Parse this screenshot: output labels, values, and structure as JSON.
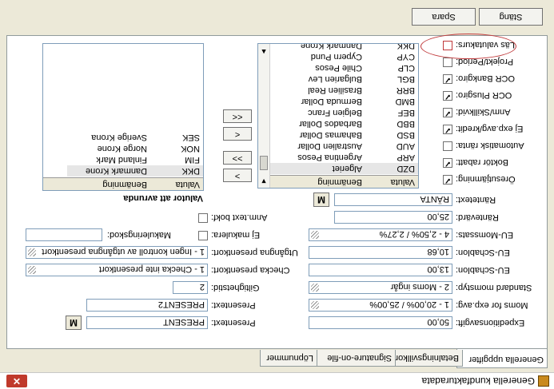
{
  "window": {
    "title": "Generella kundfakturadata",
    "close_glyph": "✕"
  },
  "tabs": [
    "Generella uppgifter",
    "Betalningsvillkor",
    "Signature-on-file",
    "Löpnummer"
  ],
  "left_fields": [
    {
      "label": "Expeditionsavgift:",
      "value": "50,00"
    },
    {
      "label": "Moms for exp.avg:",
      "value": "1 - 20,00% / 25,00%"
    },
    {
      "label": "Standard momstyp:",
      "value": "2 - Moms ingår"
    },
    {
      "label": "EU-Schablon:",
      "value": "13,00"
    },
    {
      "label": "EU-Schablon:",
      "value": "10,68"
    },
    {
      "label": "EU-Momssats:",
      "value": "4 - 2,50% / 2,27%"
    },
    {
      "label": "Räntevärd:",
      "value": "25,00"
    },
    {
      "label": "Räntetext:",
      "value": "RÄNTA"
    }
  ],
  "left_checks": [
    {
      "label": "Öresutjämning:",
      "checked": true
    },
    {
      "label": "Boktör rabatt:",
      "checked": true
    },
    {
      "label": "Automatisk ränta:",
      "checked": false
    },
    {
      "label": "Ej exp.avg/kredit:",
      "checked": true
    },
    {
      "label": "Anm/Skillkvid:",
      "checked": true
    },
    {
      "label": "OCR Plusgiro:",
      "checked": true
    },
    {
      "label": "OCR Bankgiro:",
      "checked": true
    },
    {
      "label": "Projekt/Period:",
      "checked": false
    },
    {
      "label": "Läs valutakurs:",
      "checked": false
    }
  ],
  "right_fields": {
    "presentext1_label": "Presentext:",
    "presentext1_value": "PRESENT",
    "presentext2_label": "Presentext:",
    "presentext2_value": "PRESENT2",
    "giltighetstid_label": "Giltighetstid:",
    "giltighetstid_value": "2",
    "checka_label": "Checka presentkort:",
    "checka_value": "1 - Checka inte presentkort",
    "utgangna_label": "Utgångna presentkort:",
    "utgangna_value": "1 - Ingen kontroll av utgångna presentkort",
    "ej_makulera_label": "Ej makulera:",
    "makuleringskod_label": "Makuleringskod:",
    "makuleringskod_value": "",
    "anm_text_label": "Anm.text bokf:"
  },
  "currency_list": {
    "columns": [
      "Valuta",
      "Benämning"
    ],
    "rows": [
      [
        "DZD",
        "Algeriet"
      ],
      [
        "ARP",
        "Argentina Pesos"
      ],
      [
        "AUD",
        "Australien Dollar"
      ],
      [
        "BSD",
        "Bahamas Dollar"
      ],
      [
        "BBD",
        "Barbados Dollar"
      ],
      [
        "BEF",
        "Belgien Franc"
      ],
      [
        "BMD",
        "Bermuda Dollar"
      ],
      [
        "BRR",
        "Brasilien Real"
      ],
      [
        "BGL",
        "Bulgarien Lev"
      ],
      [
        "CLP",
        "Chile Pesos"
      ],
      [
        "CYP",
        "Cypern Pund"
      ],
      [
        "DKK",
        "Danmark Krone"
      ]
    ]
  },
  "selected_list": {
    "title": "Valutor att avrunda",
    "columns": [
      "Valuta",
      "Benämning"
    ],
    "rows": [
      [
        "DKK",
        "Danmark Krone"
      ],
      [
        "FIM",
        "Finland Mark"
      ],
      [
        "NOK",
        "Norge Krone"
      ],
      [
        "SEK",
        "Sverige Krona"
      ]
    ]
  },
  "transfer_buttons": [
    "<<",
    "<",
    ">>",
    ">"
  ],
  "buttons": {
    "save": "Spara",
    "close": "Stäng"
  },
  "search_glyph": "M"
}
